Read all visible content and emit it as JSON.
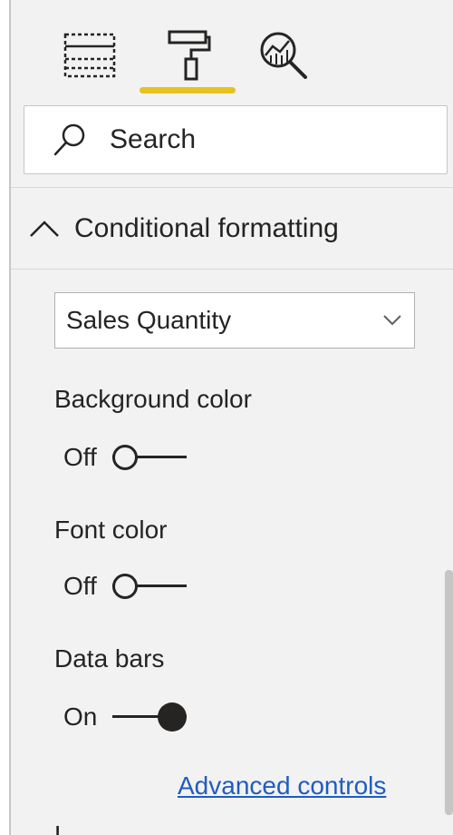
{
  "tabs": [
    {
      "name": "fields",
      "icon": "table-fields-icon"
    },
    {
      "name": "format",
      "icon": "paint-roller-icon",
      "active": true
    },
    {
      "name": "analytics",
      "icon": "analytics-magnifier-icon"
    }
  ],
  "colors": {
    "active_tab": "#e8c21c",
    "link": "#1f5cc0",
    "pane_bg": "#f2f2f2"
  },
  "search": {
    "placeholder": "Search"
  },
  "section": {
    "title": "Conditional formatting",
    "expanded": true
  },
  "field_select": {
    "value": "Sales Quantity"
  },
  "options": {
    "background_color": {
      "label": "Background color",
      "state": "Off"
    },
    "font_color": {
      "label": "Font color",
      "state": "Off"
    },
    "data_bars": {
      "label": "Data bars",
      "state": "On"
    }
  },
  "advanced_link": "Advanced controls",
  "next_section_partial": "L"
}
